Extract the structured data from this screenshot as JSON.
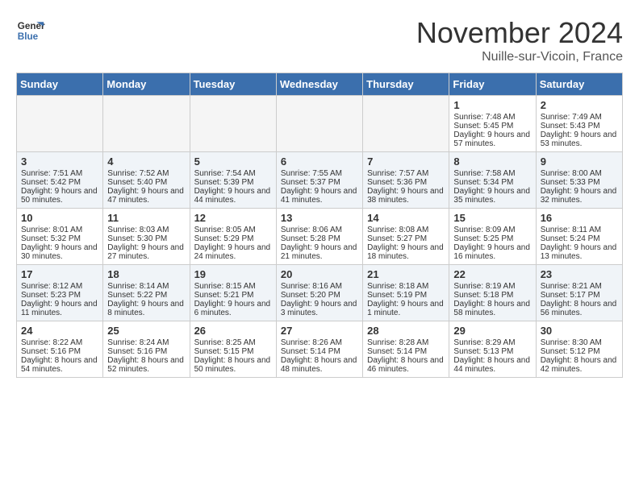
{
  "header": {
    "logo_text_line1": "General",
    "logo_text_line2": "Blue",
    "month": "November 2024",
    "location": "Nuille-sur-Vicoin, France"
  },
  "days_of_week": [
    "Sunday",
    "Monday",
    "Tuesday",
    "Wednesday",
    "Thursday",
    "Friday",
    "Saturday"
  ],
  "weeks": [
    [
      {
        "day": "",
        "info": ""
      },
      {
        "day": "",
        "info": ""
      },
      {
        "day": "",
        "info": ""
      },
      {
        "day": "",
        "info": ""
      },
      {
        "day": "",
        "info": ""
      },
      {
        "day": "1",
        "info": "Sunrise: 7:48 AM\nSunset: 5:45 PM\nDaylight: 9 hours and 57 minutes."
      },
      {
        "day": "2",
        "info": "Sunrise: 7:49 AM\nSunset: 5:43 PM\nDaylight: 9 hours and 53 minutes."
      }
    ],
    [
      {
        "day": "3",
        "info": "Sunrise: 7:51 AM\nSunset: 5:42 PM\nDaylight: 9 hours and 50 minutes."
      },
      {
        "day": "4",
        "info": "Sunrise: 7:52 AM\nSunset: 5:40 PM\nDaylight: 9 hours and 47 minutes."
      },
      {
        "day": "5",
        "info": "Sunrise: 7:54 AM\nSunset: 5:39 PM\nDaylight: 9 hours and 44 minutes."
      },
      {
        "day": "6",
        "info": "Sunrise: 7:55 AM\nSunset: 5:37 PM\nDaylight: 9 hours and 41 minutes."
      },
      {
        "day": "7",
        "info": "Sunrise: 7:57 AM\nSunset: 5:36 PM\nDaylight: 9 hours and 38 minutes."
      },
      {
        "day": "8",
        "info": "Sunrise: 7:58 AM\nSunset: 5:34 PM\nDaylight: 9 hours and 35 minutes."
      },
      {
        "day": "9",
        "info": "Sunrise: 8:00 AM\nSunset: 5:33 PM\nDaylight: 9 hours and 32 minutes."
      }
    ],
    [
      {
        "day": "10",
        "info": "Sunrise: 8:01 AM\nSunset: 5:32 PM\nDaylight: 9 hours and 30 minutes."
      },
      {
        "day": "11",
        "info": "Sunrise: 8:03 AM\nSunset: 5:30 PM\nDaylight: 9 hours and 27 minutes."
      },
      {
        "day": "12",
        "info": "Sunrise: 8:05 AM\nSunset: 5:29 PM\nDaylight: 9 hours and 24 minutes."
      },
      {
        "day": "13",
        "info": "Sunrise: 8:06 AM\nSunset: 5:28 PM\nDaylight: 9 hours and 21 minutes."
      },
      {
        "day": "14",
        "info": "Sunrise: 8:08 AM\nSunset: 5:27 PM\nDaylight: 9 hours and 18 minutes."
      },
      {
        "day": "15",
        "info": "Sunrise: 8:09 AM\nSunset: 5:25 PM\nDaylight: 9 hours and 16 minutes."
      },
      {
        "day": "16",
        "info": "Sunrise: 8:11 AM\nSunset: 5:24 PM\nDaylight: 9 hours and 13 minutes."
      }
    ],
    [
      {
        "day": "17",
        "info": "Sunrise: 8:12 AM\nSunset: 5:23 PM\nDaylight: 9 hours and 11 minutes."
      },
      {
        "day": "18",
        "info": "Sunrise: 8:14 AM\nSunset: 5:22 PM\nDaylight: 9 hours and 8 minutes."
      },
      {
        "day": "19",
        "info": "Sunrise: 8:15 AM\nSunset: 5:21 PM\nDaylight: 9 hours and 6 minutes."
      },
      {
        "day": "20",
        "info": "Sunrise: 8:16 AM\nSunset: 5:20 PM\nDaylight: 9 hours and 3 minutes."
      },
      {
        "day": "21",
        "info": "Sunrise: 8:18 AM\nSunset: 5:19 PM\nDaylight: 9 hours and 1 minute."
      },
      {
        "day": "22",
        "info": "Sunrise: 8:19 AM\nSunset: 5:18 PM\nDaylight: 8 hours and 58 minutes."
      },
      {
        "day": "23",
        "info": "Sunrise: 8:21 AM\nSunset: 5:17 PM\nDaylight: 8 hours and 56 minutes."
      }
    ],
    [
      {
        "day": "24",
        "info": "Sunrise: 8:22 AM\nSunset: 5:16 PM\nDaylight: 8 hours and 54 minutes."
      },
      {
        "day": "25",
        "info": "Sunrise: 8:24 AM\nSunset: 5:16 PM\nDaylight: 8 hours and 52 minutes."
      },
      {
        "day": "26",
        "info": "Sunrise: 8:25 AM\nSunset: 5:15 PM\nDaylight: 8 hours and 50 minutes."
      },
      {
        "day": "27",
        "info": "Sunrise: 8:26 AM\nSunset: 5:14 PM\nDaylight: 8 hours and 48 minutes."
      },
      {
        "day": "28",
        "info": "Sunrise: 8:28 AM\nSunset: 5:14 PM\nDaylight: 8 hours and 46 minutes."
      },
      {
        "day": "29",
        "info": "Sunrise: 8:29 AM\nSunset: 5:13 PM\nDaylight: 8 hours and 44 minutes."
      },
      {
        "day": "30",
        "info": "Sunrise: 8:30 AM\nSunset: 5:12 PM\nDaylight: 8 hours and 42 minutes."
      }
    ]
  ]
}
